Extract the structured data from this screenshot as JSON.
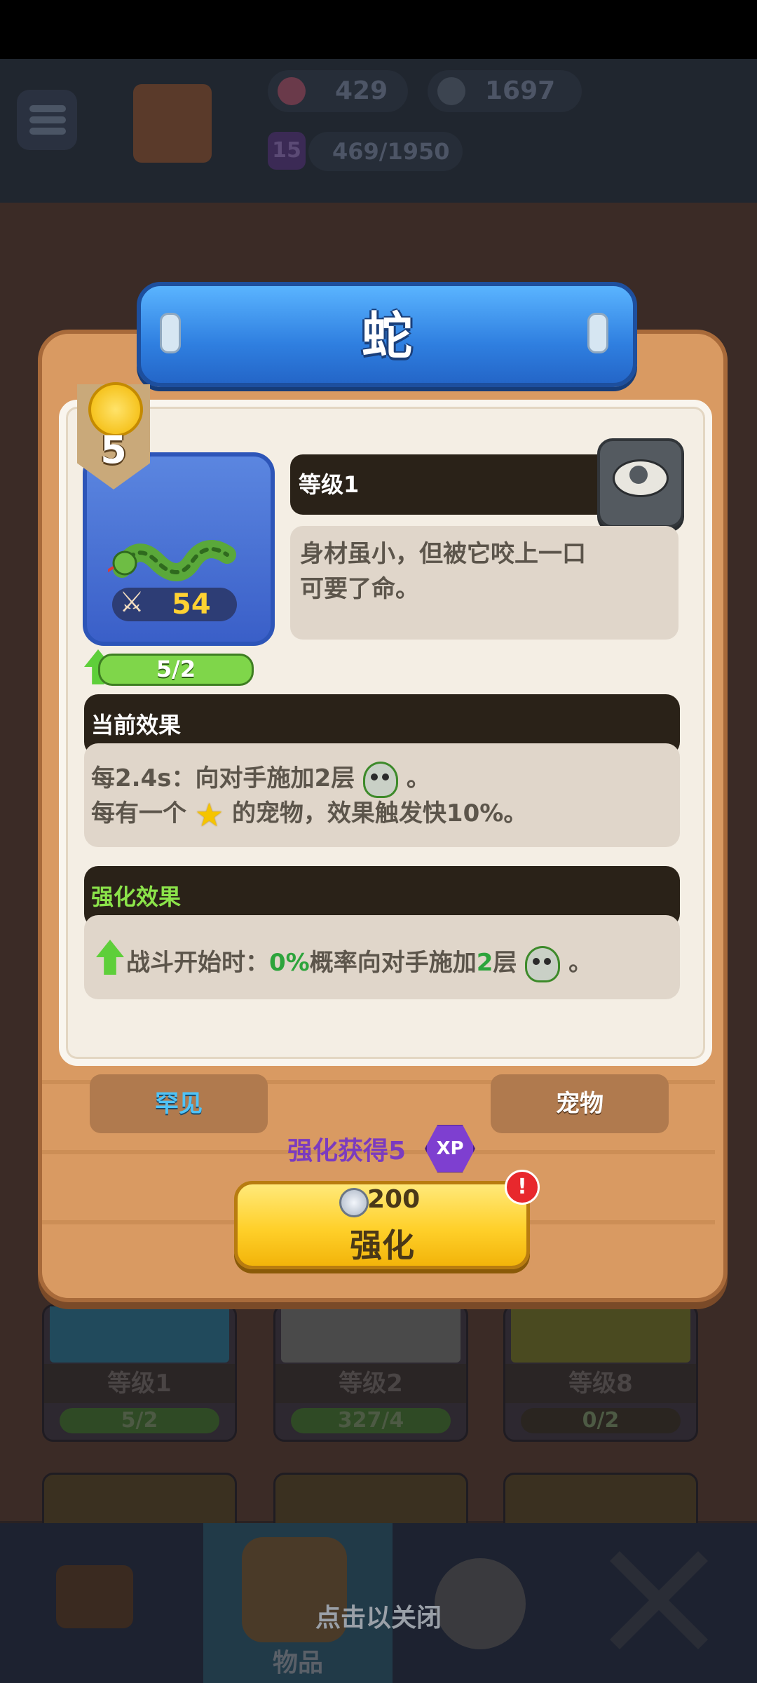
{
  "resources": {
    "gems": "429",
    "silver": "1697",
    "level": "15",
    "xp_progress": "469/1950"
  },
  "popup": {
    "title": "蛇",
    "tier": "5",
    "power": "54",
    "card_progress": "5/2",
    "level_label": "等级1",
    "description": "身材虽小，但被它咬上一口可要了命。",
    "current_effect": {
      "header": "当前效果",
      "line1_prefix": "每2.4s：向对手施加2层",
      "line1_suffix": "。",
      "line2_prefix": "每有一个",
      "line2_suffix": "的宠物，效果触发快10%。"
    },
    "upgrade_effect": {
      "header": "强化效果",
      "prefix": "战斗开始时：",
      "chance": "0%",
      "mid": "概率向对手施加",
      "stacks": "2",
      "unit": "层",
      "suffix": "。"
    },
    "rarity_tag": "罕见",
    "type_tag": "宠物",
    "xp_gain_label": "强化获得5",
    "xp_badge": "XP",
    "upgrade_cost": "200",
    "upgrade_label": "强化",
    "alert": "!"
  },
  "background_cards": [
    {
      "label": "等级1",
      "progress": "5/2"
    },
    {
      "label": "等级2",
      "progress": "327/4"
    },
    {
      "label": "等级8",
      "progress": "0/2"
    }
  ],
  "bottom_nav": {
    "items_label": "物品"
  },
  "close_hint": "点击以关闭",
  "colors": {
    "accent_blue": "#2f7fe0",
    "gold": "#ffd02a",
    "panel": "#d99a62",
    "green": "#2da43c",
    "purple": "#7b3bbf"
  }
}
